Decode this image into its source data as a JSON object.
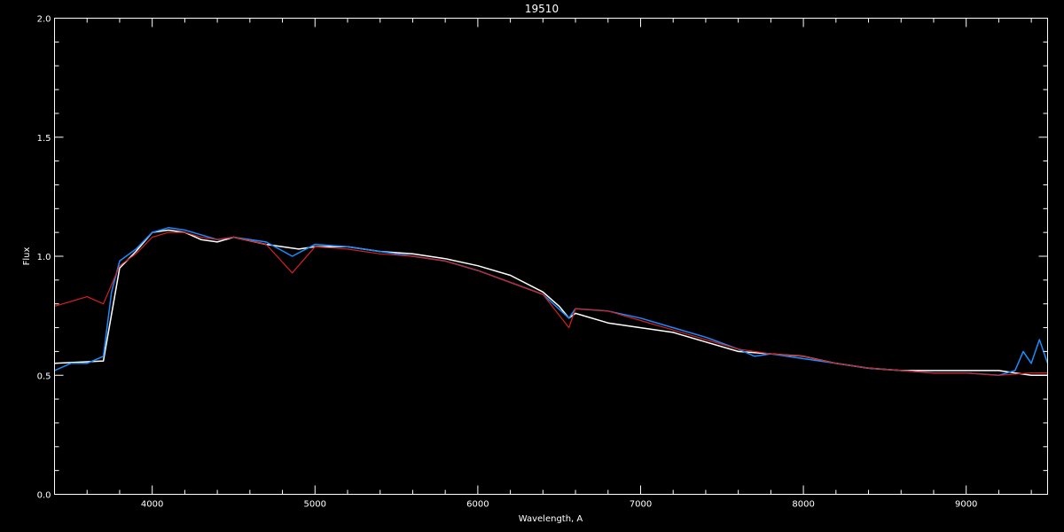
{
  "chart_data": {
    "type": "line",
    "title": "19510",
    "xlabel": "Wavelength, A",
    "ylabel": "Flux",
    "xlim": [
      3400,
      9500
    ],
    "ylim": [
      0.0,
      2.0
    ],
    "x_ticks": [
      4000,
      5000,
      6000,
      7000,
      8000,
      9000
    ],
    "y_ticks": [
      0.0,
      0.5,
      1.0,
      1.5,
      2.0
    ],
    "x_tick_labels": [
      "4000",
      "5000",
      "6000",
      "7000",
      "8000",
      "9000"
    ],
    "y_tick_labels": [
      "0.0",
      "0.5",
      "1.0",
      "1.5",
      "2.0"
    ],
    "grid": false,
    "background": "#000000",
    "colors": {
      "axes": "#ffffff",
      "white_spectrum": "#ffffff",
      "blue_spectrum": "#1a8cff",
      "model_red": "#d42020"
    },
    "series": [
      {
        "color": "#ffffff",
        "x": [
          3400,
          3700,
          3800,
          3900,
          4000,
          4100,
          4200,
          4300,
          4400,
          4500,
          4700,
          4900,
          5000,
          5200,
          5400,
          5600,
          5800,
          6000,
          6200,
          6400,
          6500,
          6560,
          6600,
          6800,
          7000,
          7200,
          7400,
          7600,
          7800,
          8000,
          8200,
          8400,
          8600,
          8800,
          9000,
          9200,
          9300,
          9400,
          9500
        ],
        "values": [
          0.55,
          0.56,
          0.95,
          1.02,
          1.1,
          1.11,
          1.1,
          1.07,
          1.06,
          1.08,
          1.05,
          1.03,
          1.04,
          1.04,
          1.02,
          1.01,
          0.99,
          0.96,
          0.92,
          0.85,
          0.79,
          0.74,
          0.76,
          0.72,
          0.7,
          0.68,
          0.64,
          0.6,
          0.59,
          0.58,
          0.55,
          0.53,
          0.52,
          0.52,
          0.52,
          0.52,
          0.51,
          0.5,
          0.5
        ]
      },
      {
        "color": "#1a8cff",
        "x": [
          3400,
          3500,
          3600,
          3700,
          3750,
          3800,
          3900,
          4000,
          4100,
          4200,
          4300,
          4400,
          4500,
          4700,
          4860,
          5000,
          5200,
          5400,
          5600,
          5800,
          6000,
          6200,
          6400,
          6560,
          6600,
          6800,
          7000,
          7200,
          7400,
          7600,
          7700,
          7800,
          8000,
          8200,
          8400,
          8600,
          8800,
          9000,
          9200,
          9300,
          9350,
          9400,
          9450,
          9500
        ],
        "values": [
          0.52,
          0.55,
          0.55,
          0.58,
          0.85,
          0.98,
          1.03,
          1.1,
          1.12,
          1.11,
          1.09,
          1.07,
          1.08,
          1.06,
          1.0,
          1.05,
          1.04,
          1.02,
          1.0,
          0.98,
          0.94,
          0.89,
          0.84,
          0.74,
          0.78,
          0.77,
          0.74,
          0.7,
          0.66,
          0.61,
          0.58,
          0.59,
          0.57,
          0.55,
          0.53,
          0.52,
          0.51,
          0.51,
          0.5,
          0.52,
          0.6,
          0.55,
          0.65,
          0.55
        ]
      },
      {
        "color": "#d42020",
        "x": [
          3400,
          3500,
          3600,
          3700,
          3800,
          3900,
          4000,
          4100,
          4200,
          4300,
          4400,
          4500,
          4700,
          4860,
          5000,
          5200,
          5400,
          5600,
          5800,
          6000,
          6200,
          6400,
          6560,
          6600,
          6800,
          7000,
          7200,
          7400,
          7600,
          7800,
          8000,
          8200,
          8400,
          8600,
          8800,
          9000,
          9200,
          9400,
          9500
        ],
        "values": [
          0.79,
          0.81,
          0.83,
          0.8,
          0.96,
          1.01,
          1.08,
          1.1,
          1.1,
          1.08,
          1.07,
          1.08,
          1.05,
          0.93,
          1.04,
          1.03,
          1.01,
          1.0,
          0.98,
          0.94,
          0.89,
          0.84,
          0.7,
          0.78,
          0.77,
          0.73,
          0.69,
          0.65,
          0.61,
          0.59,
          0.58,
          0.55,
          0.53,
          0.52,
          0.51,
          0.51,
          0.5,
          0.51,
          0.51
        ]
      }
    ]
  }
}
